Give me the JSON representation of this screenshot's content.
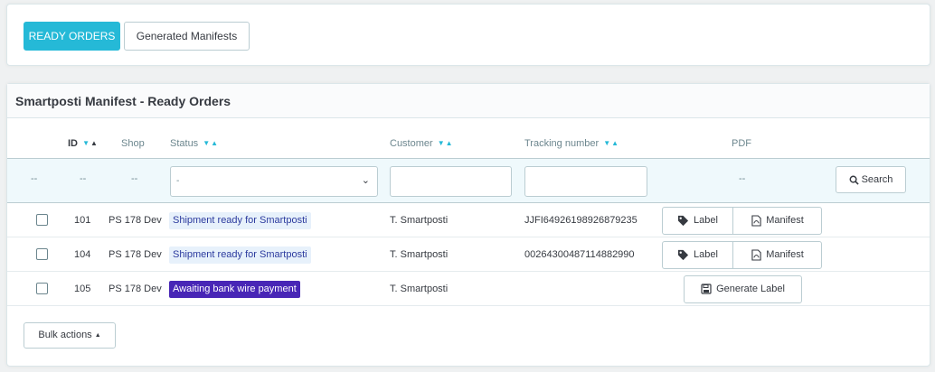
{
  "tabs": {
    "ready_orders": "READY ORDERS",
    "generated_manifests": "Generated Manifests"
  },
  "panel": {
    "title": "Smartposti Manifest - Ready Orders"
  },
  "table": {
    "headers": {
      "id": "ID",
      "shop": "Shop",
      "status": "Status",
      "customer": "Customer",
      "tracking": "Tracking number",
      "pdf": "PDF"
    },
    "filters": {
      "dash": "--",
      "status_value": "-",
      "search_label": "Search"
    },
    "rows": [
      {
        "id": "101",
        "shop": "PS 178 Dev",
        "status": "Shipment ready for Smartposti",
        "customer": "T. Smartposti",
        "tracking": "JJFI64926198926879235",
        "label_btn": "Label",
        "manifest_btn": "Manifest"
      },
      {
        "id": "104",
        "shop": "PS 178 Dev",
        "status": "Shipment ready for Smartposti",
        "customer": "T. Smartposti",
        "tracking": "00264300487114882990",
        "label_btn": "Label",
        "manifest_btn": "Manifest"
      },
      {
        "id": "105",
        "shop": "PS 178 Dev",
        "status": "Awaiting bank wire payment",
        "customer": "T. Smartposti",
        "tracking": "",
        "generate_btn": "Generate Label"
      }
    ]
  },
  "bulk_actions": "Bulk actions",
  "colors": {
    "accent": "#25b9d7",
    "status_ready_bg": "#e7f1fb",
    "status_awaiting_bg": "#4826b6"
  },
  "icons": {
    "sort": "sort-arrows-icon",
    "search": "search-icon",
    "label": "tag-icon",
    "manifest": "pdf-file-icon",
    "generate": "floppy-disk-icon",
    "dropdown": "chevron-down-icon",
    "bulk": "caret-up-icon"
  }
}
